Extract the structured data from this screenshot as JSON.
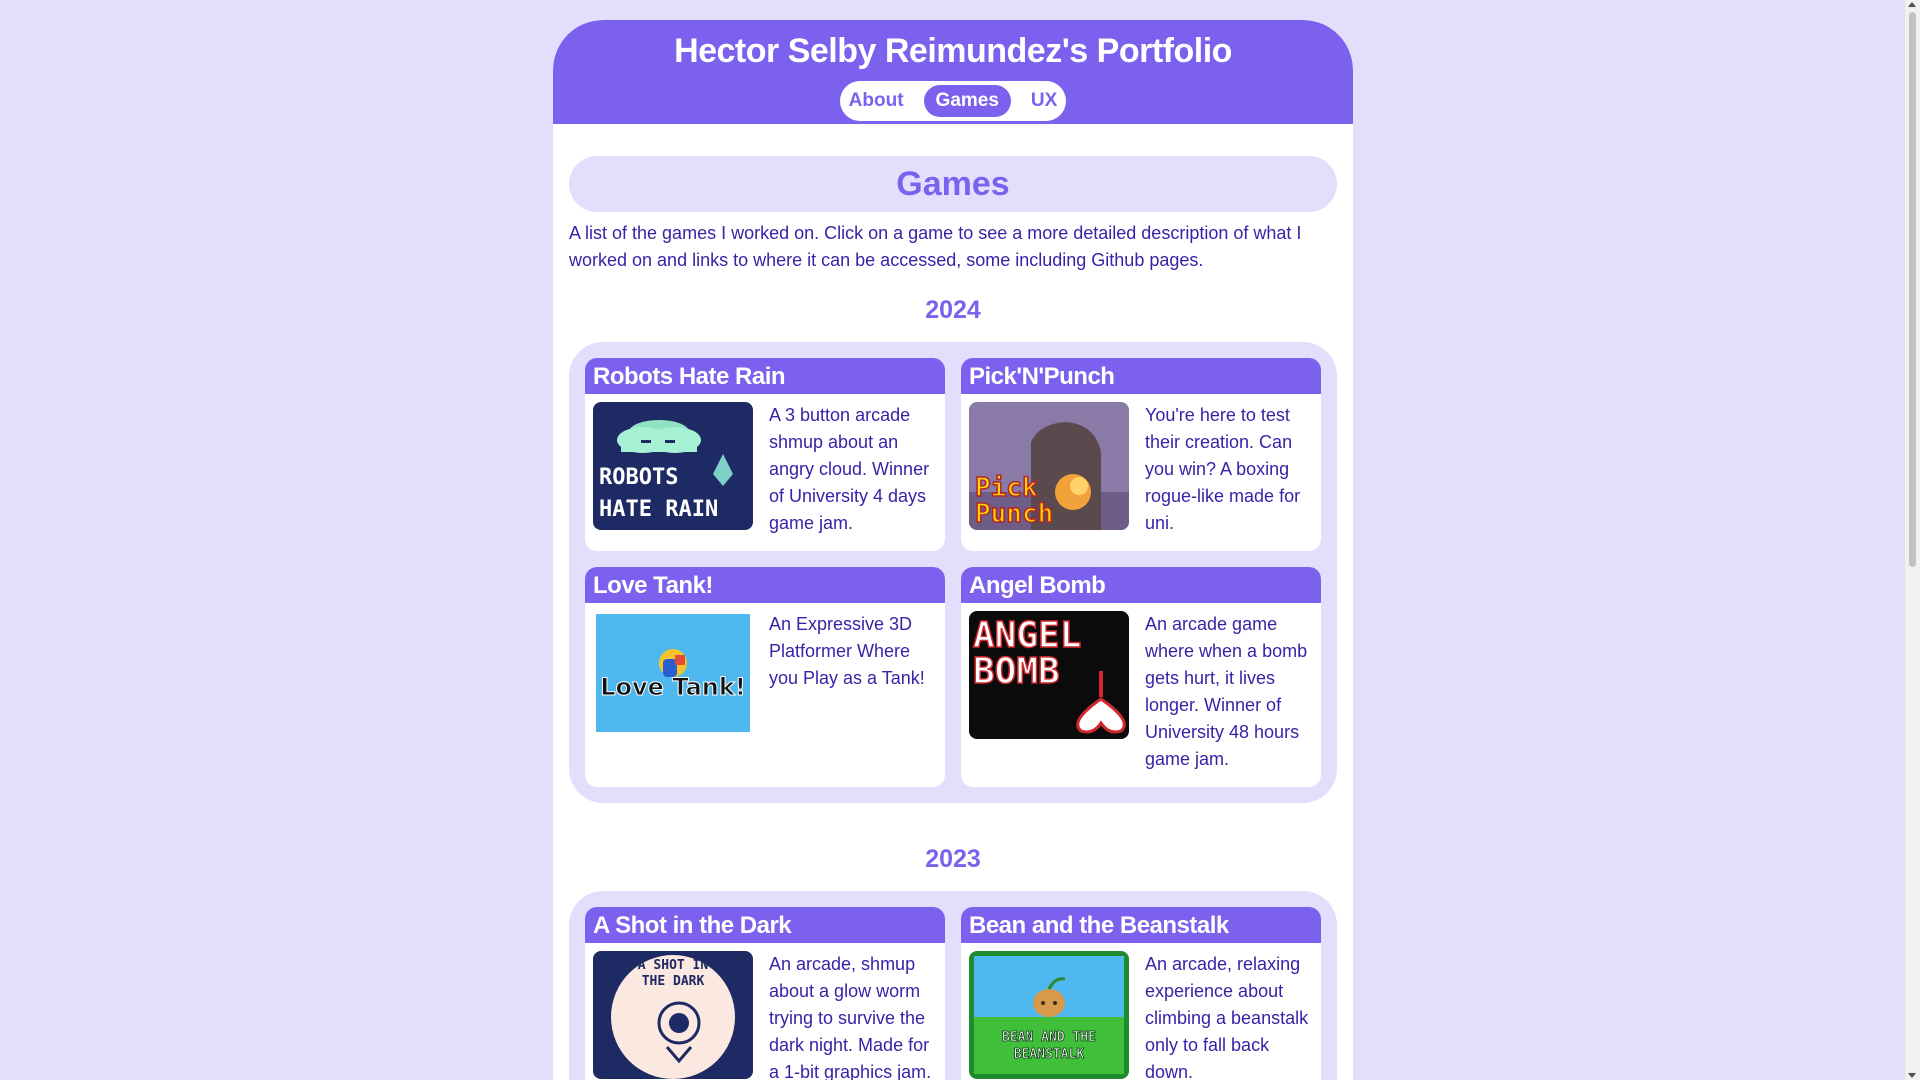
{
  "site": {
    "title": "Hector Selby Reimundez's Portfolio"
  },
  "nav": {
    "items": [
      "About",
      "Games",
      "UX"
    ],
    "active": "Games"
  },
  "section": {
    "title": "Games",
    "intro": "A list of the games I worked on. Click on a game to see a more detailed description of what I worked on and links to where it can be accessed, some including Github pages."
  },
  "years": [
    {
      "year": "2024",
      "games": [
        {
          "title": "Robots Hate Rain",
          "description": "A 3 button arcade shmup about an angry cloud. Winner of University 4 days game jam.",
          "thumb_text": [
            "ROBOTS",
            "HATE RAIN"
          ]
        },
        {
          "title": "Pick'N'Punch",
          "description": "You're here to test their creation. Can you win? A boxing rogue-like made for uni.",
          "thumb_text": [
            "Pick",
            "Punch"
          ]
        },
        {
          "title": "Love Tank!",
          "description": "An Expressive 3D Platformer Where you Play as a Tank!",
          "thumb_text": [
            "Love Tank!"
          ]
        },
        {
          "title": "Angel Bomb",
          "description": "An arcade game where when a bomb gets hurt, it lives longer. Winner of University 48 hours game jam.",
          "thumb_text": [
            "ANGEL",
            "BOMB"
          ]
        }
      ]
    },
    {
      "year": "2023",
      "games": [
        {
          "title": "A Shot in the Dark",
          "description": "An arcade, shmup about a glow worm trying to survive the dark night. Made for a 1-bit graphics jam.",
          "thumb_text": [
            "A SHOT IN",
            "THE DARK"
          ]
        },
        {
          "title": "Bean and the Beanstalk",
          "description": "An arcade, relaxing experience about climbing a beanstalk only to fall back down.",
          "thumb_text": [
            "BEAN AND THE",
            "BEANSTALK"
          ]
        }
      ]
    }
  ],
  "colors": {
    "accent": "#7b61ee",
    "background": "#e3defb",
    "text": "#3a22a8"
  }
}
